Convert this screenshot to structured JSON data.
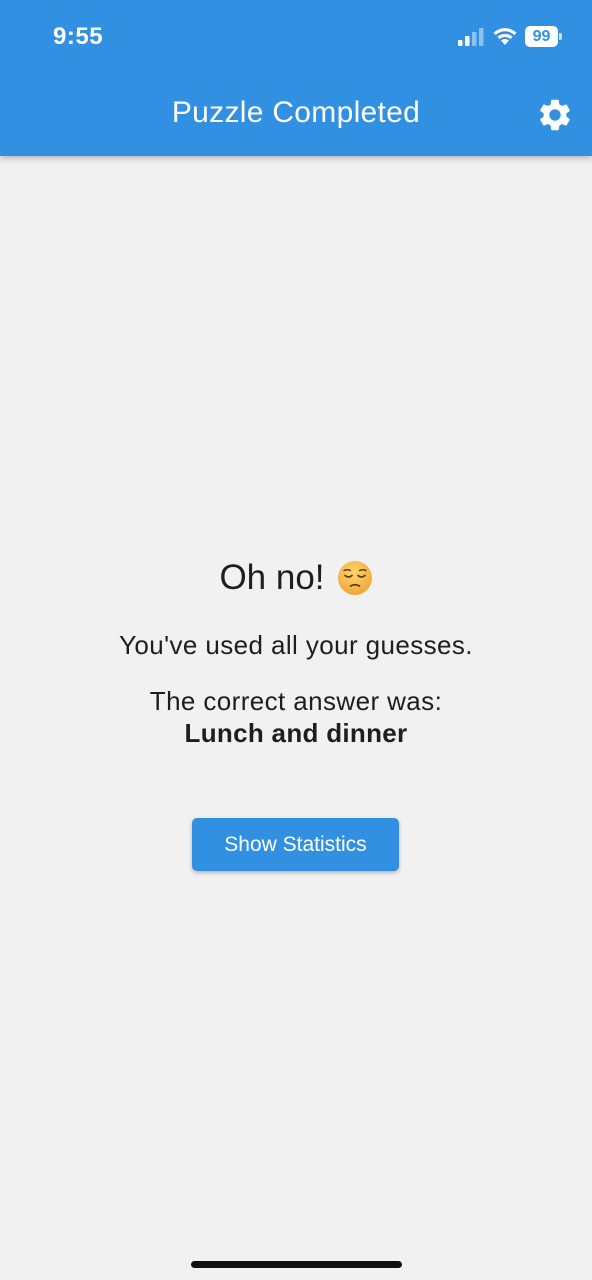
{
  "status_bar": {
    "time": "9:55",
    "battery": "99",
    "icons": [
      "signal-icon",
      "wifi-icon",
      "battery-icon"
    ]
  },
  "header": {
    "title": "Puzzle Completed",
    "settings_icon": "gear-icon",
    "background_color": "#3190e1"
  },
  "result": {
    "headline": "Oh no!",
    "emoji_icon": "pensive-face-emoji",
    "message": "You've used all your guesses.",
    "answer_label": "The correct answer was:",
    "answer_value": "Lunch and dinner"
  },
  "actions": {
    "show_statistics_label": "Show Statistics"
  },
  "colors": {
    "accent": "#3190e1",
    "background": "#f1f1f1",
    "text": "#1e1e1e"
  }
}
